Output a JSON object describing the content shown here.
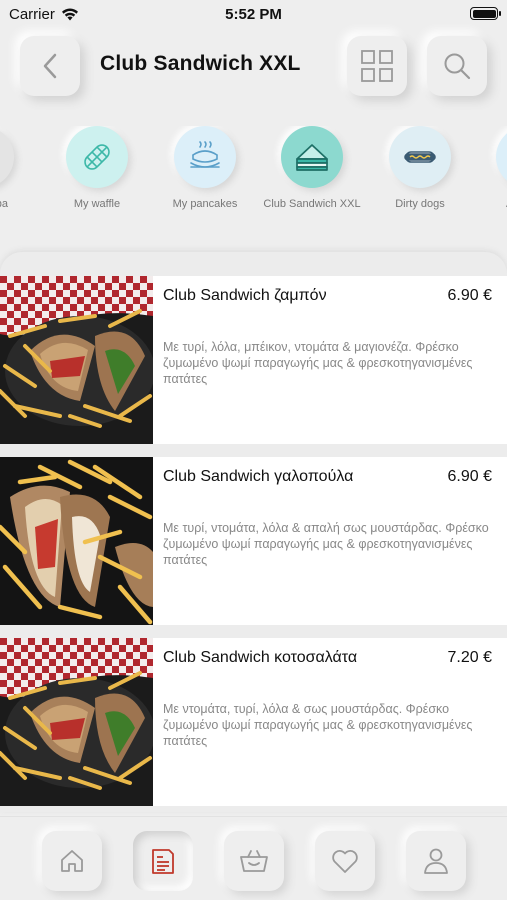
{
  "status_bar": {
    "carrier": "Carrier",
    "time": "5:52 PM"
  },
  "header": {
    "title": "Club Sandwich XXL"
  },
  "categories": [
    {
      "label": "pa",
      "icon": "generic-food-icon"
    },
    {
      "label": "My waffle",
      "icon": "waffle-icon"
    },
    {
      "label": "My pancakes",
      "icon": "pancakes-icon"
    },
    {
      "label": "Club Sandwich XXL",
      "icon": "sandwich-icon"
    },
    {
      "label": "Dirty dogs",
      "icon": "hotdog-icon"
    },
    {
      "label": "A",
      "icon": "generic-food-icon"
    }
  ],
  "items": [
    {
      "name": "Club Sandwich ζαμπόν",
      "price": "6.90 €",
      "description": "Με τυρί, λόλα, μπέικον, ντομάτα & μαγιονέζα. Φρέσκο ζυμωμένο ψωμί παραγωγής μας & φρεσκοτηγανισμένες πατάτες"
    },
    {
      "name": "Club Sandwich γαλοπούλα",
      "price": "6.90 €",
      "description": "Με τυρί, ντομάτα, λόλα & απαλή σως μουστάρδας. Φρέσκο ζυμωμένο ψωμί παραγωγής μας & φρεσκοτηγανισμένες πατάτες"
    },
    {
      "name": "Club Sandwich κοτοσαλάτα",
      "price": "7.20 €",
      "description": "Με ντομάτα, τυρί, λόλα & σως μουστάρδας. Φρέσκο ζυμωμένο ψωμί παραγωγής μας & φρεσκοτηγανισμένες πατάτες"
    }
  ],
  "tabbar": {
    "tabs": [
      {
        "icon": "home-icon"
      },
      {
        "icon": "menu-icon",
        "active": true
      },
      {
        "icon": "basket-icon"
      },
      {
        "icon": "heart-icon"
      },
      {
        "icon": "profile-icon"
      }
    ]
  },
  "colors": {
    "background": "#eeeeee",
    "accent_red": "#c0392b",
    "teal_category": "#3cb8a8",
    "icon_gray": "#9a9a9a"
  }
}
